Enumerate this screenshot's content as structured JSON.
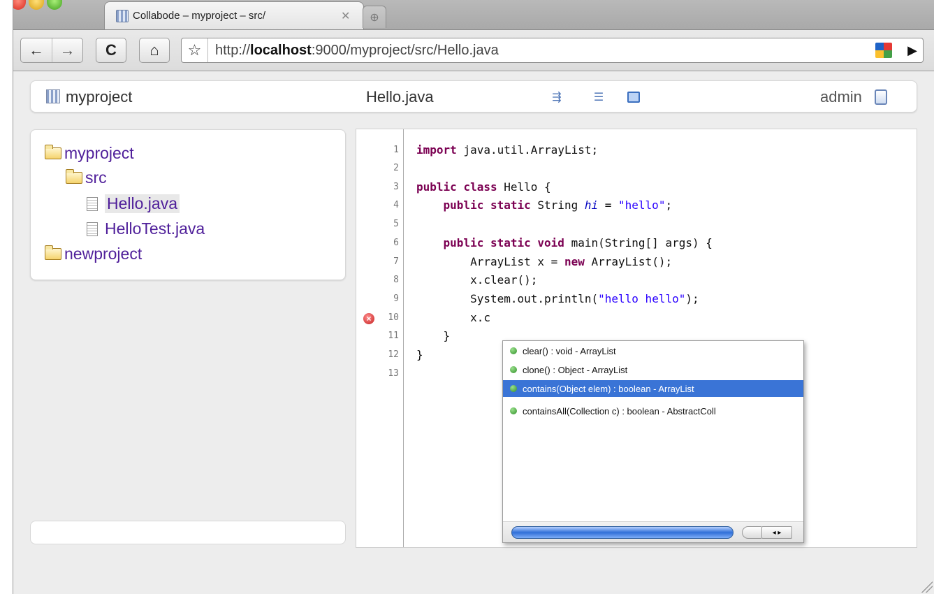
{
  "browser": {
    "tab": {
      "title": "Collabode – myproject – src/",
      "close": "✕"
    },
    "newtab": "⊕",
    "nav": {
      "back": "←",
      "forward": "→",
      "reload": "C",
      "home": "⌂"
    },
    "url": {
      "prefix": "http://",
      "host": "localhost",
      "rest": ":9000/myproject/src/Hello.java"
    },
    "go": "▶"
  },
  "app": {
    "project": "myproject",
    "file": "Hello.java",
    "user": "admin",
    "icons": [
      "format-code-icon",
      "indent-icon",
      "console-icon"
    ]
  },
  "tree": [
    {
      "label": "myproject",
      "type": "folder"
    },
    {
      "label": "src",
      "type": "folder"
    },
    {
      "label": "Hello.java",
      "type": "file",
      "selected": true
    },
    {
      "label": "HelloTest.java",
      "type": "file"
    },
    {
      "label": "newproject",
      "type": "folder"
    }
  ],
  "editor": {
    "line_numbers": [
      "1",
      "2",
      "3",
      "4",
      "5",
      "6",
      "7",
      "8",
      "9",
      "10",
      "11",
      "12",
      "13"
    ],
    "error_line": "10",
    "code": [
      "import java.util.ArrayList;",
      "",
      "public class Hello {",
      "    public static String hi = \"hello\";",
      "",
      "    public static void main(String[] args) {",
      "        ArrayList x = new ArrayList();",
      "        x.clear();",
      "        System.out.println(\"hello hello\");",
      "        x.c",
      "    }",
      "}",
      ""
    ]
  },
  "autocomplete": {
    "items": [
      "clear() : void - ArrayList",
      "clone() : Object - ArrayList",
      "contains(Object elem) : boolean - ArrayList",
      "containsAll(Collection c) : boolean - AbstractColl"
    ],
    "selected_index": 2,
    "scroll_arrows": "◂ ▸"
  }
}
